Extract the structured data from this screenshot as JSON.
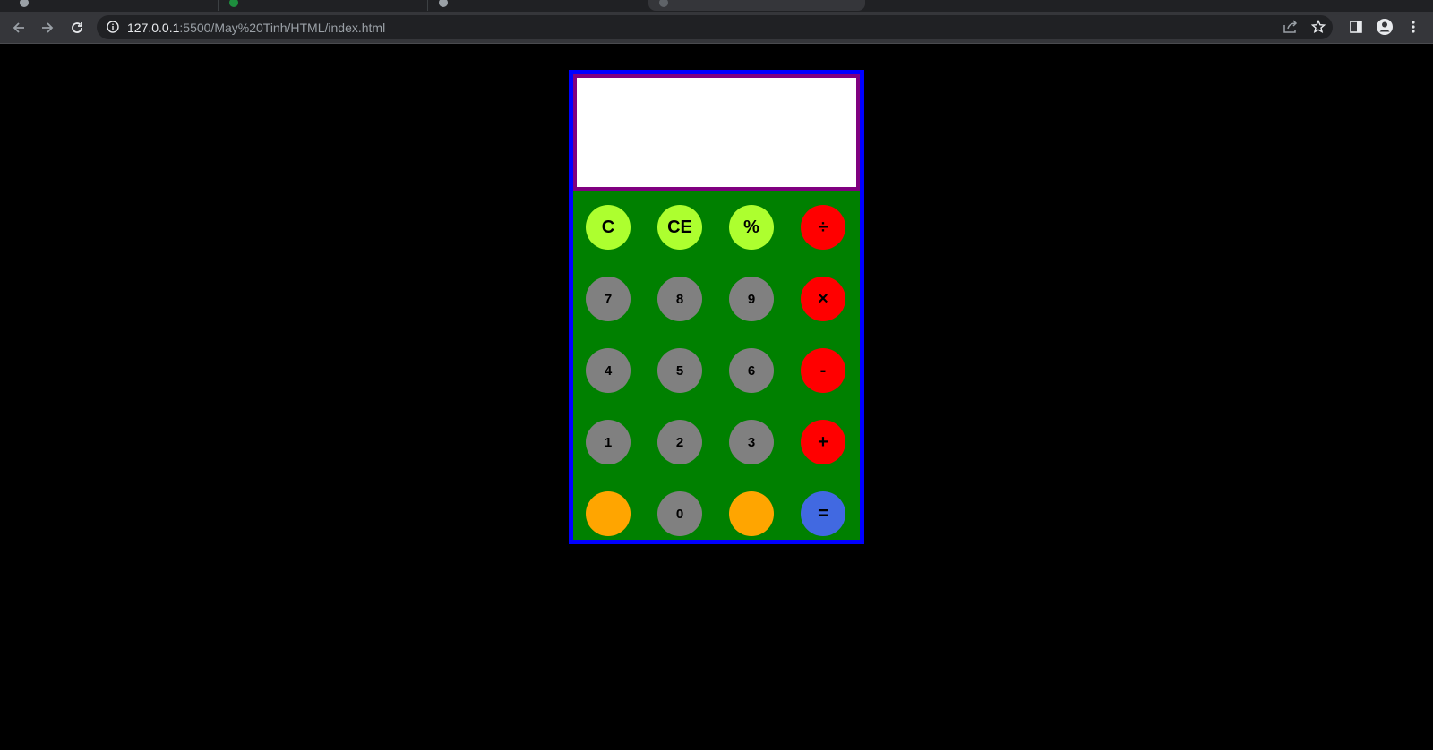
{
  "browser": {
    "url_host": "127.0.0.1",
    "url_path": ":5500/May%20Tinh/HTML/index.html"
  },
  "calculator": {
    "display_value": "",
    "keys": {
      "clear": "C",
      "clear_entry": "CE",
      "percent": "%",
      "divide": "÷",
      "seven": "7",
      "eight": "8",
      "nine": "9",
      "multiply": "×",
      "four": "4",
      "five": "5",
      "six": "6",
      "subtract": "-",
      "one": "1",
      "two": "2",
      "three": "3",
      "add": "+",
      "left_blank": "",
      "zero": "0",
      "right_blank": "",
      "equals": "="
    },
    "colors": {
      "body": "#008000",
      "border": "#0000ff",
      "display_border": "#800080",
      "display": "#ffffff",
      "function_keys": "#adff2f",
      "number_keys": "#808080",
      "operator_keys": "#ff0000",
      "blank_keys": "#ffa500",
      "equals_key": "#4169e1"
    }
  }
}
